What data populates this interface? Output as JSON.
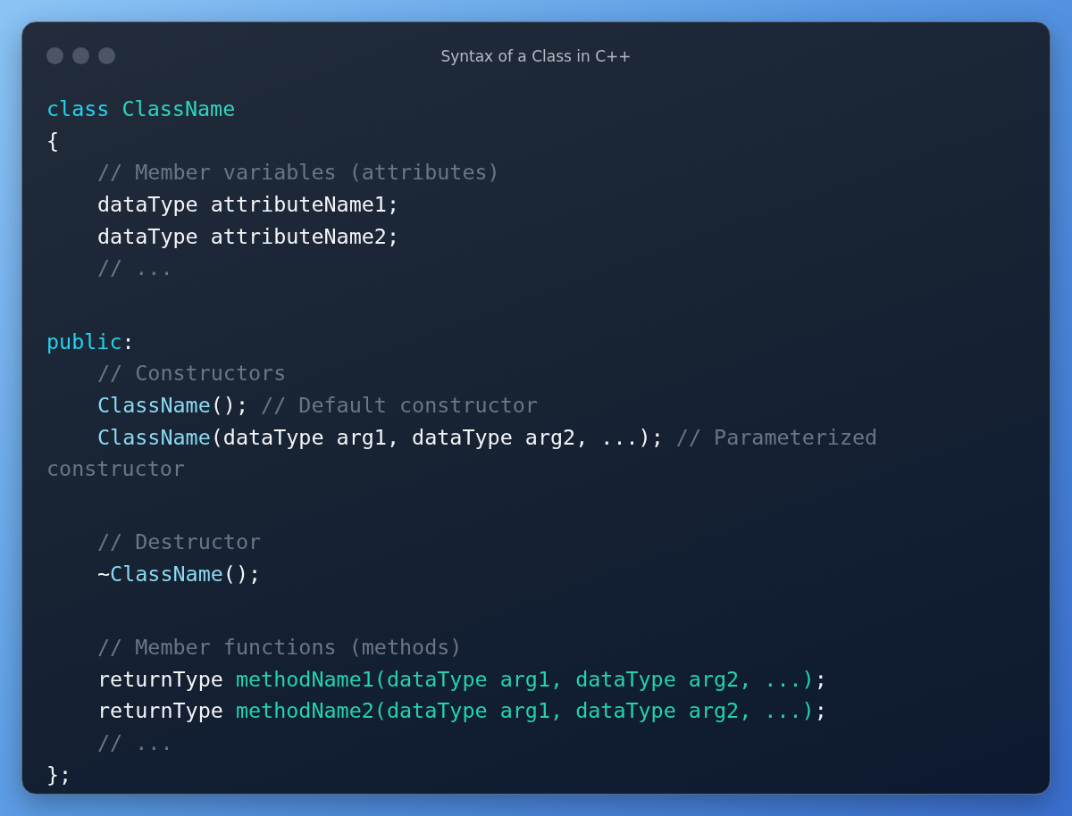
{
  "window": {
    "title": "Syntax of a Class in C++"
  },
  "code_lines": [
    {
      "kind": "code",
      "tokens": [
        {
          "kind": "keyword",
          "text": "class "
        },
        {
          "kind": "type",
          "text": "ClassName"
        }
      ]
    },
    {
      "kind": "code",
      "tokens": [
        {
          "kind": "plain",
          "text": "{"
        }
      ]
    },
    {
      "kind": "indented",
      "tokens": [
        {
          "kind": "comment",
          "text": "// Member variables (attributes)"
        }
      ]
    },
    {
      "kind": "indented",
      "tokens": [
        {
          "kind": "plain",
          "text": "dataType attributeName1;"
        }
      ]
    },
    {
      "kind": "indented",
      "tokens": [
        {
          "kind": "plain",
          "text": "dataType attributeName2;"
        }
      ]
    },
    {
      "kind": "indented",
      "tokens": [
        {
          "kind": "comment",
          "text": "// ..."
        }
      ]
    },
    {
      "kind": "blank"
    },
    {
      "kind": "code",
      "tokens": [
        {
          "kind": "keyword",
          "text": "public"
        },
        {
          "kind": "plain",
          "text": ":"
        }
      ]
    },
    {
      "kind": "indented",
      "tokens": [
        {
          "kind": "comment",
          "text": "// Constructors"
        }
      ]
    },
    {
      "kind": "indented",
      "tokens": [
        {
          "kind": "function",
          "text": "ClassName"
        },
        {
          "kind": "plain",
          "text": "(); "
        },
        {
          "kind": "comment",
          "text": "// Default constructor"
        }
      ]
    },
    {
      "kind": "indented",
      "tokens": [
        {
          "kind": "function",
          "text": "ClassName"
        },
        {
          "kind": "plain",
          "text": "(dataType arg1, dataType arg2, ...); "
        },
        {
          "kind": "comment",
          "text": "// Parameterized"
        }
      ]
    },
    {
      "kind": "code",
      "tokens": [
        {
          "kind": "comment",
          "text": "constructor"
        }
      ]
    },
    {
      "kind": "blank"
    },
    {
      "kind": "indented",
      "tokens": [
        {
          "kind": "comment",
          "text": "// Destructor"
        }
      ]
    },
    {
      "kind": "indented",
      "tokens": [
        {
          "kind": "plain",
          "text": "~"
        },
        {
          "kind": "function",
          "text": "ClassName"
        },
        {
          "kind": "plain",
          "text": "();"
        }
      ]
    },
    {
      "kind": "blank"
    },
    {
      "kind": "indented",
      "tokens": [
        {
          "kind": "comment",
          "text": "// Member functions (methods)"
        }
      ]
    },
    {
      "kind": "indented",
      "tokens": [
        {
          "kind": "plain",
          "text": "returnType "
        },
        {
          "kind": "method",
          "text": "methodName1(dataType arg1, dataType arg2, ...)"
        },
        {
          "kind": "plain",
          "text": ";"
        }
      ]
    },
    {
      "kind": "indented",
      "tokens": [
        {
          "kind": "plain",
          "text": "returnType "
        },
        {
          "kind": "method",
          "text": "methodName2(dataType arg1, dataType arg2, ...)"
        },
        {
          "kind": "plain",
          "text": ";"
        }
      ]
    },
    {
      "kind": "indented",
      "tokens": [
        {
          "kind": "comment",
          "text": "// ..."
        }
      ]
    },
    {
      "kind": "code",
      "tokens": [
        {
          "kind": "plain",
          "text": "};"
        }
      ]
    }
  ]
}
